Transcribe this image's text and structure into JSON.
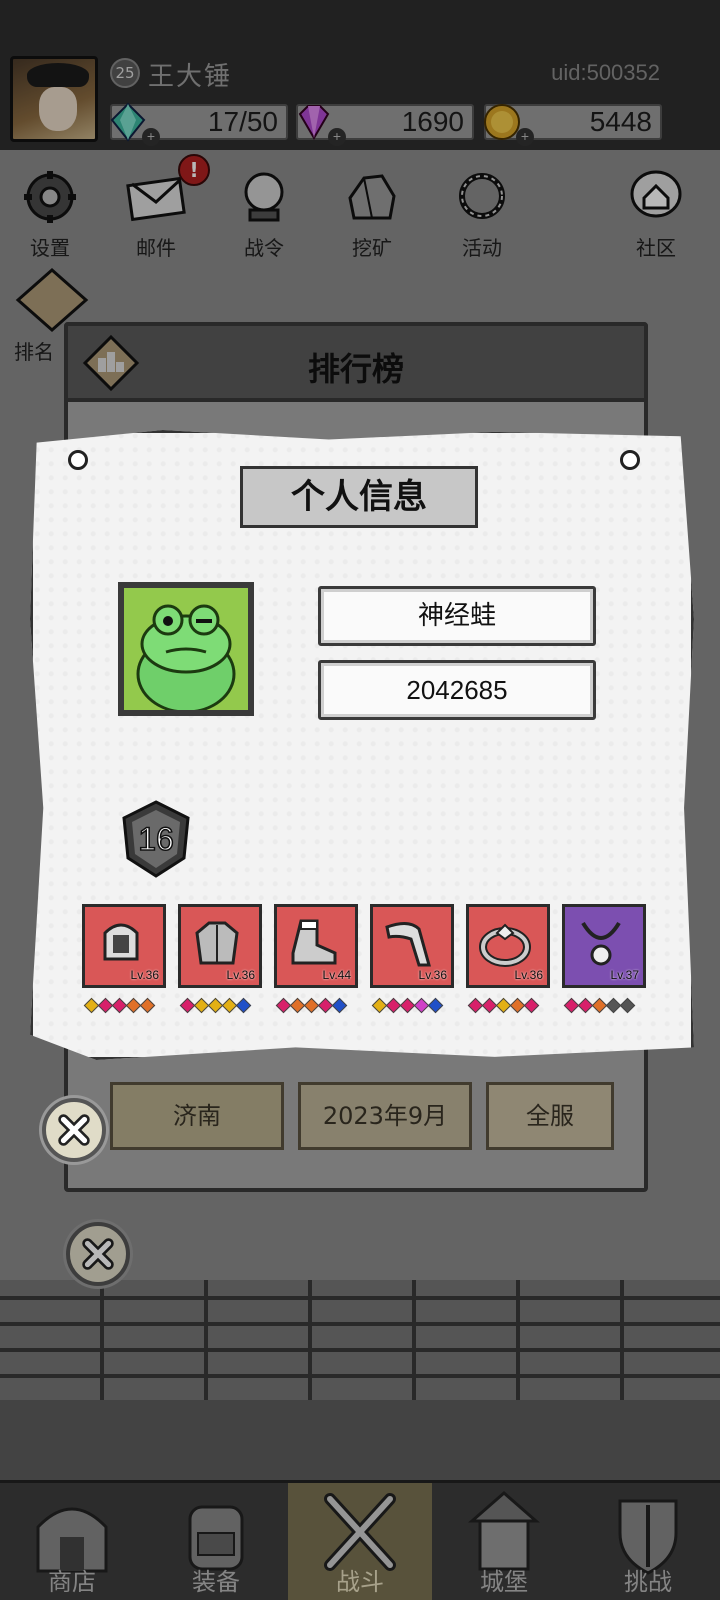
{
  "player": {
    "level": "25",
    "name": "王大锤",
    "uid": "uid:500352"
  },
  "resources": [
    {
      "icon": "teal-gem-icon",
      "value": "17/50"
    },
    {
      "icon": "purple-gem-icon",
      "value": "1690"
    },
    {
      "icon": "gold-coin-icon",
      "value": "5448"
    }
  ],
  "menu": {
    "settings": "设置",
    "mail": "邮件",
    "mail_alert": "!",
    "battle_pass": "战令",
    "mining": "挖矿",
    "events": "活动",
    "community": "社区",
    "ranking": "排名"
  },
  "ranking_window": {
    "title": "排行榜",
    "filters": [
      "济南",
      "2023年9月",
      "全服"
    ]
  },
  "info_card": {
    "title": "个人信息",
    "name": "神经蛙",
    "score": "2042685",
    "rank_level": "16",
    "equipment": [
      {
        "slot": "helmet",
        "level": "Lv.36",
        "rarity": "red",
        "gems": [
          "#e3b014",
          "#d8206a",
          "#d8206a",
          "#e07028",
          "#e07028"
        ]
      },
      {
        "slot": "armor",
        "level": "Lv.36",
        "rarity": "red",
        "gems": [
          "#d8206a",
          "#e3b014",
          "#e3b014",
          "#e3b014",
          "#2050c8"
        ]
      },
      {
        "slot": "boots",
        "level": "Lv.44",
        "rarity": "red",
        "gems": [
          "#d8206a",
          "#e07028",
          "#e07028",
          "#d8206a",
          "#2050c8"
        ]
      },
      {
        "slot": "glove",
        "level": "Lv.36",
        "rarity": "red",
        "gems": [
          "#e3b014",
          "#d8206a",
          "#d8206a",
          "#d040c8",
          "#2050c8"
        ]
      },
      {
        "slot": "ring",
        "level": "Lv.36",
        "rarity": "red",
        "gems": [
          "#d8206a",
          "#d8206a",
          "#e3b014",
          "#e07028",
          "#d8206a"
        ]
      },
      {
        "slot": "necklace",
        "level": "Lv.37",
        "rarity": "purple",
        "gems": [
          "#d8206a",
          "#d8206a",
          "#e07028",
          "#555555",
          "#555555"
        ]
      }
    ]
  },
  "bottom_nav": [
    {
      "label": "商店",
      "icon": "shop-icon",
      "active": false
    },
    {
      "label": "装备",
      "icon": "backpack-icon",
      "active": false
    },
    {
      "label": "战斗",
      "icon": "crossed-swords-icon",
      "active": true
    },
    {
      "label": "城堡",
      "icon": "castle-icon",
      "active": false
    },
    {
      "label": "挑战",
      "icon": "challenge-shield-icon",
      "active": false
    }
  ]
}
